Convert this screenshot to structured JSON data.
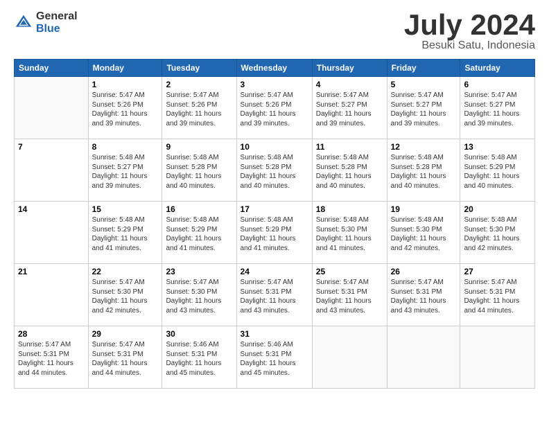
{
  "header": {
    "logo_general": "General",
    "logo_blue": "Blue",
    "month_title": "July 2024",
    "location": "Besuki Satu, Indonesia"
  },
  "days_of_week": [
    "Sunday",
    "Monday",
    "Tuesday",
    "Wednesday",
    "Thursday",
    "Friday",
    "Saturday"
  ],
  "weeks": [
    [
      {
        "day": "",
        "info": ""
      },
      {
        "day": "1",
        "info": "Sunrise: 5:47 AM\nSunset: 5:26 PM\nDaylight: 11 hours\nand 39 minutes."
      },
      {
        "day": "2",
        "info": "Sunrise: 5:47 AM\nSunset: 5:26 PM\nDaylight: 11 hours\nand 39 minutes."
      },
      {
        "day": "3",
        "info": "Sunrise: 5:47 AM\nSunset: 5:26 PM\nDaylight: 11 hours\nand 39 minutes."
      },
      {
        "day": "4",
        "info": "Sunrise: 5:47 AM\nSunset: 5:27 PM\nDaylight: 11 hours\nand 39 minutes."
      },
      {
        "day": "5",
        "info": "Sunrise: 5:47 AM\nSunset: 5:27 PM\nDaylight: 11 hours\nand 39 minutes."
      },
      {
        "day": "6",
        "info": "Sunrise: 5:47 AM\nSunset: 5:27 PM\nDaylight: 11 hours\nand 39 minutes."
      }
    ],
    [
      {
        "day": "7",
        "info": ""
      },
      {
        "day": "8",
        "info": "Sunrise: 5:48 AM\nSunset: 5:27 PM\nDaylight: 11 hours\nand 39 minutes."
      },
      {
        "day": "9",
        "info": "Sunrise: 5:48 AM\nSunset: 5:28 PM\nDaylight: 11 hours\nand 40 minutes."
      },
      {
        "day": "10",
        "info": "Sunrise: 5:48 AM\nSunset: 5:28 PM\nDaylight: 11 hours\nand 40 minutes."
      },
      {
        "day": "11",
        "info": "Sunrise: 5:48 AM\nSunset: 5:28 PM\nDaylight: 11 hours\nand 40 minutes."
      },
      {
        "day": "12",
        "info": "Sunrise: 5:48 AM\nSunset: 5:28 PM\nDaylight: 11 hours\nand 40 minutes."
      },
      {
        "day": "13",
        "info": "Sunrise: 5:48 AM\nSunset: 5:29 PM\nDaylight: 11 hours\nand 40 minutes."
      }
    ],
    [
      {
        "day": "14",
        "info": ""
      },
      {
        "day": "15",
        "info": "Sunrise: 5:48 AM\nSunset: 5:29 PM\nDaylight: 11 hours\nand 41 minutes."
      },
      {
        "day": "16",
        "info": "Sunrise: 5:48 AM\nSunset: 5:29 PM\nDaylight: 11 hours\nand 41 minutes."
      },
      {
        "day": "17",
        "info": "Sunrise: 5:48 AM\nSunset: 5:29 PM\nDaylight: 11 hours\nand 41 minutes."
      },
      {
        "day": "18",
        "info": "Sunrise: 5:48 AM\nSunset: 5:30 PM\nDaylight: 11 hours\nand 41 minutes."
      },
      {
        "day": "19",
        "info": "Sunrise: 5:48 AM\nSunset: 5:30 PM\nDaylight: 11 hours\nand 42 minutes."
      },
      {
        "day": "20",
        "info": "Sunrise: 5:48 AM\nSunset: 5:30 PM\nDaylight: 11 hours\nand 42 minutes."
      }
    ],
    [
      {
        "day": "21",
        "info": ""
      },
      {
        "day": "22",
        "info": "Sunrise: 5:47 AM\nSunset: 5:30 PM\nDaylight: 11 hours\nand 42 minutes."
      },
      {
        "day": "23",
        "info": "Sunrise: 5:47 AM\nSunset: 5:30 PM\nDaylight: 11 hours\nand 43 minutes."
      },
      {
        "day": "24",
        "info": "Sunrise: 5:47 AM\nSunset: 5:31 PM\nDaylight: 11 hours\nand 43 minutes."
      },
      {
        "day": "25",
        "info": "Sunrise: 5:47 AM\nSunset: 5:31 PM\nDaylight: 11 hours\nand 43 minutes."
      },
      {
        "day": "26",
        "info": "Sunrise: 5:47 AM\nSunset: 5:31 PM\nDaylight: 11 hours\nand 43 minutes."
      },
      {
        "day": "27",
        "info": "Sunrise: 5:47 AM\nSunset: 5:31 PM\nDaylight: 11 hours\nand 44 minutes."
      }
    ],
    [
      {
        "day": "28",
        "info": "Sunrise: 5:47 AM\nSunset: 5:31 PM\nDaylight: 11 hours\nand 44 minutes."
      },
      {
        "day": "29",
        "info": "Sunrise: 5:47 AM\nSunset: 5:31 PM\nDaylight: 11 hours\nand 44 minutes."
      },
      {
        "day": "30",
        "info": "Sunrise: 5:46 AM\nSunset: 5:31 PM\nDaylight: 11 hours\nand 45 minutes."
      },
      {
        "day": "31",
        "info": "Sunrise: 5:46 AM\nSunset: 5:31 PM\nDaylight: 11 hours\nand 45 minutes."
      },
      {
        "day": "",
        "info": ""
      },
      {
        "day": "",
        "info": ""
      },
      {
        "day": "",
        "info": ""
      }
    ]
  ],
  "week1_sun_info": "",
  "week2_sun_info": "",
  "week3_sun_info": "",
  "week4_sun_info": ""
}
